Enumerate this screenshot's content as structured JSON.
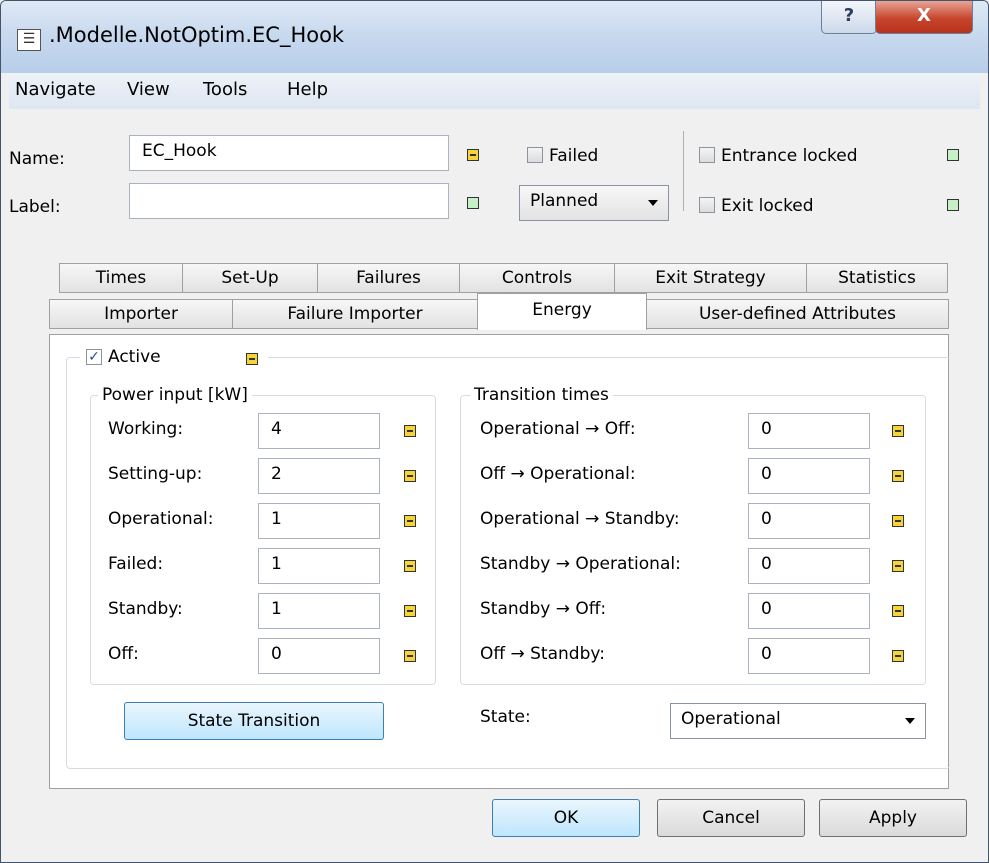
{
  "window": {
    "title": ".Modelle.NotOptim.EC_Hook",
    "help_symbol": "?",
    "close_symbol": "X"
  },
  "menu": [
    "Navigate",
    "View",
    "Tools",
    "Help"
  ],
  "header": {
    "name_label": "Name:",
    "name_value": "EC_Hook",
    "label_label": "Label:",
    "label_value": "",
    "failed_label": "Failed",
    "status_value": "Planned",
    "entrance_locked_label": "Entrance locked",
    "exit_locked_label": "Exit locked"
  },
  "tabs_row1": [
    "Times",
    "Set-Up",
    "Failures",
    "Controls",
    "Exit Strategy",
    "Statistics"
  ],
  "tabs_row2": [
    "Importer",
    "Failure Importer",
    "Energy",
    "User-defined Attributes"
  ],
  "energy": {
    "active_label": "Active",
    "power_group": "Power input [kW]",
    "power": [
      {
        "label": "Working:",
        "value": "4"
      },
      {
        "label": "Setting-up:",
        "value": "2"
      },
      {
        "label": "Operational:",
        "value": "1"
      },
      {
        "label": "Failed:",
        "value": "1"
      },
      {
        "label": "Standby:",
        "value": "1"
      },
      {
        "label": "Off:",
        "value": "0"
      }
    ],
    "transition_group": "Transition times",
    "transitions": [
      {
        "label": "Operational → Off:",
        "value": "0"
      },
      {
        "label": "Off → Operational:",
        "value": "0"
      },
      {
        "label": "Operational → Standby:",
        "value": "0"
      },
      {
        "label": "Standby → Operational:",
        "value": "0"
      },
      {
        "label": "Standby → Off:",
        "value": "0"
      },
      {
        "label": "Off → Standby:",
        "value": "0"
      }
    ],
    "state_transition_button": "State Transition",
    "state_label": "State:",
    "state_value": "Operational"
  },
  "footer": {
    "ok": "OK",
    "cancel": "Cancel",
    "apply": "Apply"
  },
  "colors": {
    "indicator_yellow": "#f5d33b",
    "indicator_green": "#c6f0c6",
    "close_red": "#c7452d"
  }
}
